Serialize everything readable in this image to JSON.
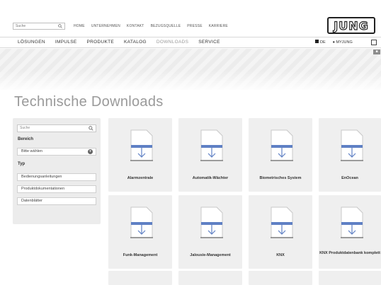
{
  "header": {
    "search_placeholder": "Suche",
    "links": [
      "HOME",
      "UNTERNEHMEN",
      "KONTAKT",
      "BEZUGSQUELLE",
      "PRESSE",
      "KARRIERE"
    ],
    "logo_text": "JUNG"
  },
  "mainnav": {
    "items": [
      "LÖSUNGEN",
      "IMPULSE",
      "PRODUKTE",
      "KATALOG",
      "DOWNLOADS",
      "SERVICE"
    ],
    "active": "DOWNLOADS",
    "lang": "DE",
    "account": "MYJUNG"
  },
  "page": {
    "title": "Technische Downloads"
  },
  "sidebar": {
    "search_placeholder": "Suche",
    "bereich_label": "Bereich",
    "select_value": "Bitte wählen",
    "typ_label": "Typ",
    "types": [
      "Bedienungsanleitungen",
      "Produktdokumentationen",
      "Datenblätter"
    ]
  },
  "tiles": [
    {
      "label": "Alarmzentrale"
    },
    {
      "label": "Automatik-Wächter"
    },
    {
      "label": "Biometrisches System"
    },
    {
      "label": "EnOcean"
    },
    {
      "label": "Funk-Management"
    },
    {
      "label": "Jalousie-Management"
    },
    {
      "label": "KNX"
    },
    {
      "label": "KNX Produktdatenbank komplett"
    }
  ],
  "colors": {
    "accent_blue": "#5f80c4",
    "tile_bg": "#efefef",
    "sidebar_bg": "#ececec"
  }
}
